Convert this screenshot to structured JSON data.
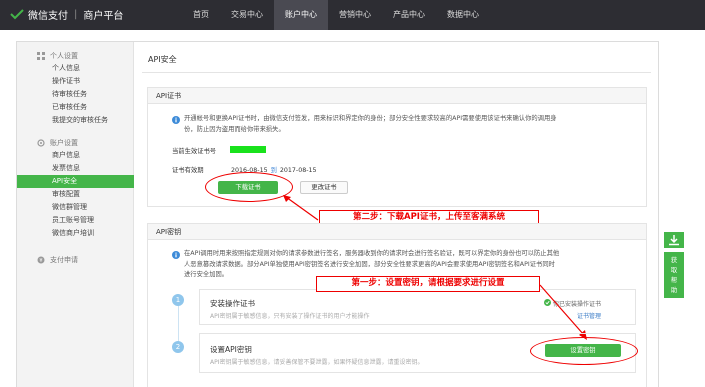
{
  "header": {
    "brand": "微信支付",
    "separator": "|",
    "platform": "商户平台",
    "nav": [
      "首页",
      "交易中心",
      "账户中心",
      "营销中心",
      "产品中心",
      "数据中心"
    ]
  },
  "sidebar": {
    "groups": [
      {
        "title": "个人设置",
        "items": [
          "个人信息",
          "操作证书",
          "待审核任务",
          "已审核任务",
          "我提交的审核任务"
        ]
      },
      {
        "title": "账户设置",
        "items": [
          "商户信息",
          "发票信息",
          "API安全",
          "审核配置",
          "微信群管理",
          "员工账号管理",
          "微信商户培训"
        ]
      },
      {
        "title": "支付申请",
        "items": []
      }
    ],
    "active_item": "API安全"
  },
  "page": {
    "title": "API安全"
  },
  "cert_panel": {
    "heading": "API证书",
    "notice_line1": "开通帐号和更换API证书时，由微信支付签发，用来标识和界定你的身份；部分安全性要求较高的API需要使用该证书来确认你的调用身",
    "notice_line2": "份，防止因为盗用而给你带来损失。",
    "current_label": "当前生效证书号",
    "validity_label": "证书有效期",
    "date_from": "2016-08-15",
    "date_to_word": "到",
    "date_to": "2017-08-15",
    "download_button": "下载证书",
    "change_button": "更改证书"
  },
  "key_panel": {
    "heading": "API密钥",
    "notice_line1": "在API调用时用来按照指定规则对你的请求参数进行签名，服务器收到你的请求时会进行签名验证，既可以界定你的身份也可以防止其他",
    "notice_line2": "人恶意篡改请求数据。部分API单独使用API密钥签名进行安全加固，部分安全性要求更高的API会要求使用API密钥签名和API证书同时",
    "notice_line3": "进行安全加固。",
    "step1_num": "1",
    "step1_title": "安装操作证书",
    "step1_sub": "API密钥属于敏感信息，只有安装了操作证书的用户才能操作",
    "step1_status": "你已安装操作证书",
    "step1_link": "证书管理",
    "step2_num": "2",
    "step2_title": "设置API密钥",
    "step2_sub": "API密钥属于敏感信息，请妥善保管不要泄露，如果怀疑信息泄露，请重设密钥。",
    "step2_button": "设置密钥"
  },
  "annotations": {
    "step2_text": "第二步：下载API证书，上传至客满系统",
    "step1_text": "第一步：设置密钥，请根据要求进行设置"
  },
  "right_tools": {
    "download_icon": "download-icon",
    "help_button": "获取帮助"
  },
  "colors": {
    "accent": "#44b549",
    "topbar": "#2d2d33",
    "annotation": "#e00000",
    "highlight": "#19e21c",
    "step_circle": "#8fc6ec",
    "link": "#3d7ec7"
  }
}
